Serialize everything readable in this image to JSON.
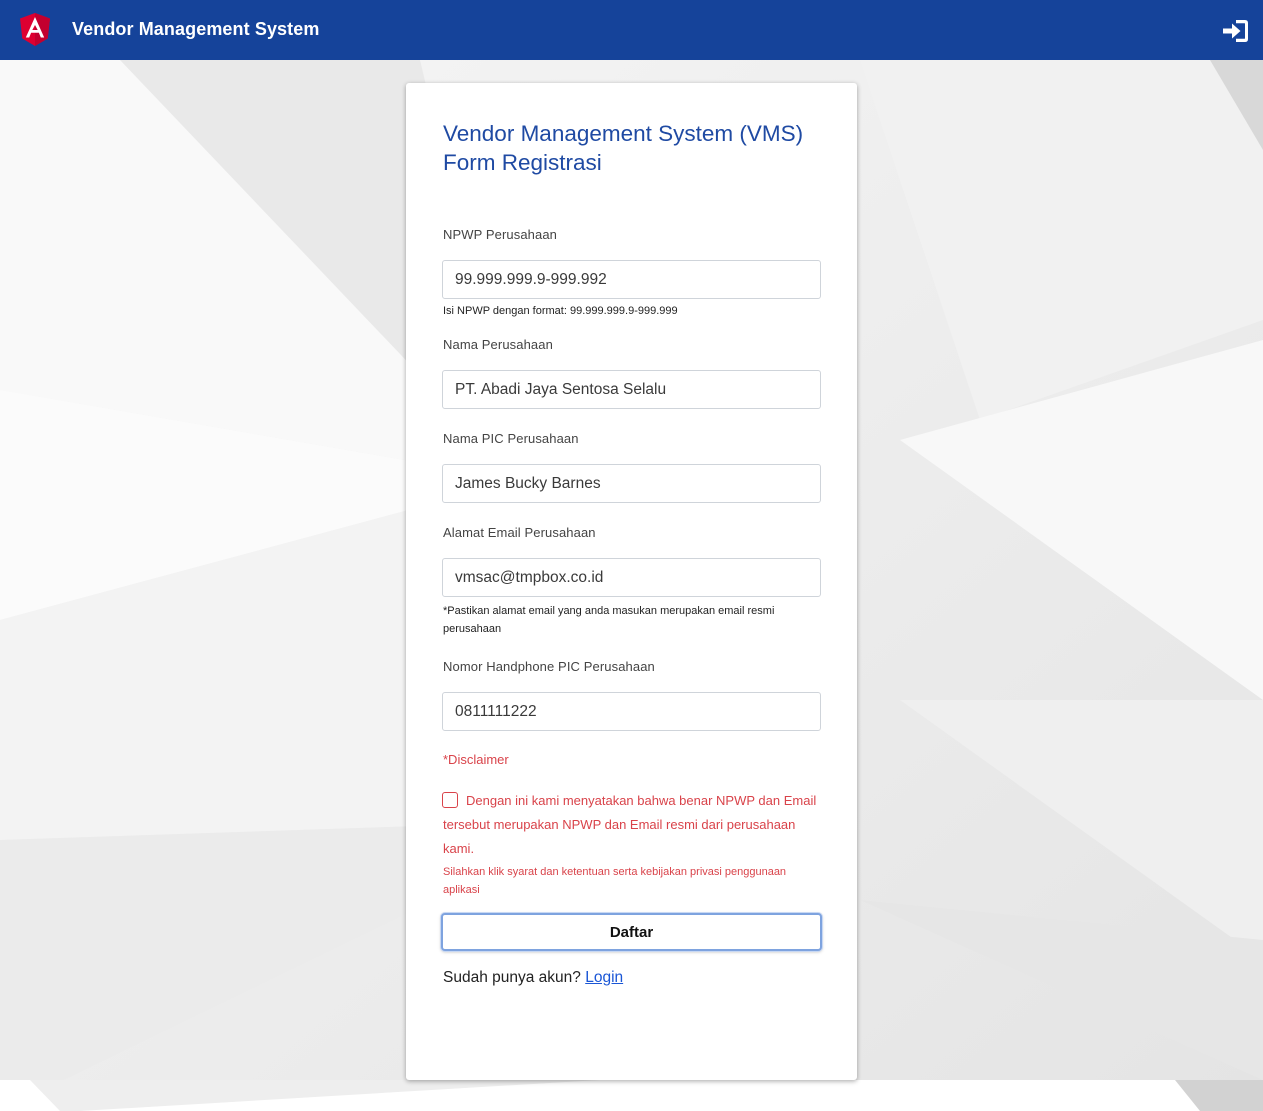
{
  "header": {
    "app_title": "Vendor Management System",
    "brand_color": "#15439a",
    "logo_icon": "angular-shield-icon",
    "login_icon": "sign-in-icon"
  },
  "form": {
    "title_line1": "Vendor Management System (VMS)",
    "title_line2": "Form Registrasi",
    "npwp": {
      "label": "NPWP Perusahaan",
      "value": "99.999.999.9-999.992",
      "hint": "Isi NPWP dengan format: 99.999.999.9-999.999"
    },
    "company_name": {
      "label": "Nama Perusahaan",
      "value": "PT. Abadi Jaya Sentosa Selalu"
    },
    "pic_name": {
      "label": "Nama PIC Perusahaan",
      "value": "James Bucky Barnes"
    },
    "email": {
      "label": "Alamat Email Perusahaan",
      "value": "vmsac@tmpbox.co.id",
      "hint": "*Pastikan alamat email yang anda masukan merupakan email resmi perusahaan"
    },
    "phone": {
      "label": "Nomor Handphone PIC Perusahaan",
      "value": "0811111222"
    },
    "disclaimer": {
      "title": "*Disclaimer",
      "checkbox_checked": false,
      "statement": "Dengan ini kami menyatakan bahwa benar NPWP dan Email tersebut merupakan NPWP dan Email resmi dari perusahaan kami.",
      "terms": "Silahkan klik syarat dan ketentuan serta kebijakan privasi penggunaan aplikasi"
    },
    "submit_label": "Daftar",
    "account_prompt": "Sudah punya akun?",
    "login_link": "Login"
  },
  "colors": {
    "title": "#1f4aa3",
    "error": "#d9434a",
    "link": "#1a56d6"
  }
}
